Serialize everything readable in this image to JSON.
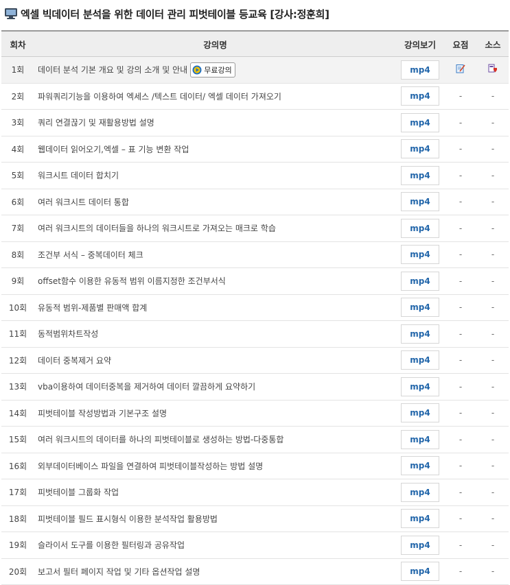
{
  "page": {
    "title": "엑셀 빅데이터 분석을 위한 데이터 관리 피벗테이블 등교육 [강사:정훈희]"
  },
  "table": {
    "headers": {
      "no": "회차",
      "title": "강의명",
      "view": "강의보기",
      "summary": "요점",
      "source": "소스"
    },
    "mp4_label": "mp4",
    "free_label": "무료강의",
    "dash": "-",
    "rows": [
      {
        "no": "1회",
        "title": "데이터 분석 기본 개요 및 강의 소개 및 안내"
      },
      {
        "no": "2회",
        "title": "파워쿼리기능을 이용하여 엑세스 /텍스트 데이터/ 엑셀 데이터 가져오기"
      },
      {
        "no": "3회",
        "title": "쿼리 연결끊기 및 재활용방법 설명"
      },
      {
        "no": "4회",
        "title": "웹데이터 읽어오기,엑셀 – 표 기능 변환 작업"
      },
      {
        "no": "5회",
        "title": "워크시트 데이터 합치기"
      },
      {
        "no": "6회",
        "title": "여러 워크시트 데이터 통합"
      },
      {
        "no": "7회",
        "title": "여러 워크시트의 데이터들을 하나의 워크시트로 가져오는 매크로 학습"
      },
      {
        "no": "8회",
        "title": "조건부 서식 – 중복데이터 체크"
      },
      {
        "no": "9회",
        "title": "offset함수 이용한 유동적 범위 이름지정한 조건부서식"
      },
      {
        "no": "10회",
        "title": "유동적 범위-제품별 판매액 합계"
      },
      {
        "no": "11회",
        "title": "동적범위차트작성"
      },
      {
        "no": "12회",
        "title": "데이터 중복제거 요약"
      },
      {
        "no": "13회",
        "title": "vba이용하여 데이터중복을 제거하여 데이터 깔끔하게 요약하기"
      },
      {
        "no": "14회",
        "title": "피벗테이블 작성방법과 기본구조 설명"
      },
      {
        "no": "15회",
        "title": "여러 워크시트의 데이터를 하나의 피벗테이블로 생성하는 방법-다중통합"
      },
      {
        "no": "16회",
        "title": "외부데이터베이스 파일을 연결하여 피벗테이블작성하는 방법 설명"
      },
      {
        "no": "17회",
        "title": "피벗테이블 그룹화 작업"
      },
      {
        "no": "18회",
        "title": "피벗테이블 필드 표시형식 이용한 분석작업 활용방법"
      },
      {
        "no": "19회",
        "title": "슬라이서 도구를 이용한 필터링과 공유작업"
      },
      {
        "no": "20회",
        "title": "보고서 필터 페이지 작업 및 기타 옵션작업 설명"
      }
    ]
  }
}
